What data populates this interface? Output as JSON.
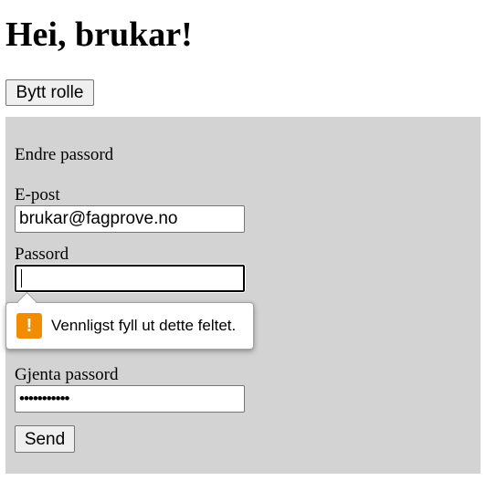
{
  "header": {
    "title": "Hei, brukar!"
  },
  "role_button": {
    "label": "Bytt rolle"
  },
  "form": {
    "heading": "Endre passord",
    "email": {
      "label": "E-post",
      "value": "brukar@fagprove.no"
    },
    "password": {
      "label": "Passord",
      "value": ""
    },
    "repeat_password": {
      "label": "Gjenta passord",
      "masked_value": "•••••••••••"
    },
    "send_label": "Send"
  },
  "validation_tooltip": {
    "icon": "warning-icon",
    "icon_color": "#f28c00",
    "message": "Vennligst fyll ut dette feltet."
  },
  "colors": {
    "panel_background": "#d3d3d3"
  }
}
